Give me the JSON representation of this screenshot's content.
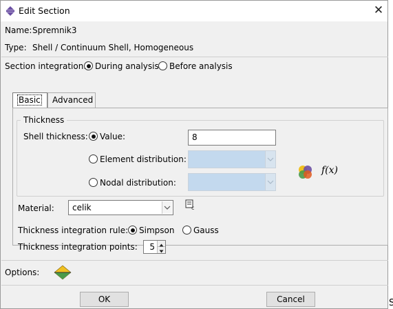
{
  "dialog": {
    "title": "Edit Section",
    "close_glyph": "✕",
    "name_label": "Name:",
    "name_value": "Spremnik3",
    "type_label": "Type:",
    "type_value": "Shell / Continuum Shell, Homogeneous",
    "section_integration": {
      "label": "Section integration:",
      "options": [
        "During analysis",
        "Before analysis"
      ],
      "selected": "During analysis"
    },
    "tabs": [
      {
        "label": "Basic",
        "active": true
      },
      {
        "label": "Advanced",
        "active": false
      }
    ],
    "thickness": {
      "group_label": "Thickness",
      "shell_thickness_label": "Shell thickness:",
      "value_option": "Value:",
      "value": "8",
      "element_distribution_option": "Element distribution:",
      "nodal_distribution_option": "Nodal distribution:",
      "selected": "Value",
      "fx_label": "f(x)"
    },
    "material": {
      "label": "Material:",
      "value": "celik",
      "create_icon": "material-create-icon"
    },
    "thickness_rule": {
      "label": "Thickness integration rule:",
      "options": [
        "Simpson",
        "Gauss"
      ],
      "selected": "Simpson"
    },
    "integration_points": {
      "label": "Thickness integration points:",
      "value": "5"
    },
    "options_label": "Options:",
    "ok_label": "OK",
    "cancel_label": "Cancel",
    "edge_glyph": "S"
  },
  "colors": {
    "dialog_bg": "#f0f0f0",
    "disabled_combo": "#c3d9ee",
    "icon_purple": "#6b4fa3",
    "icon_yellow": "#f0c020",
    "icon_green": "#4a9a4a"
  }
}
